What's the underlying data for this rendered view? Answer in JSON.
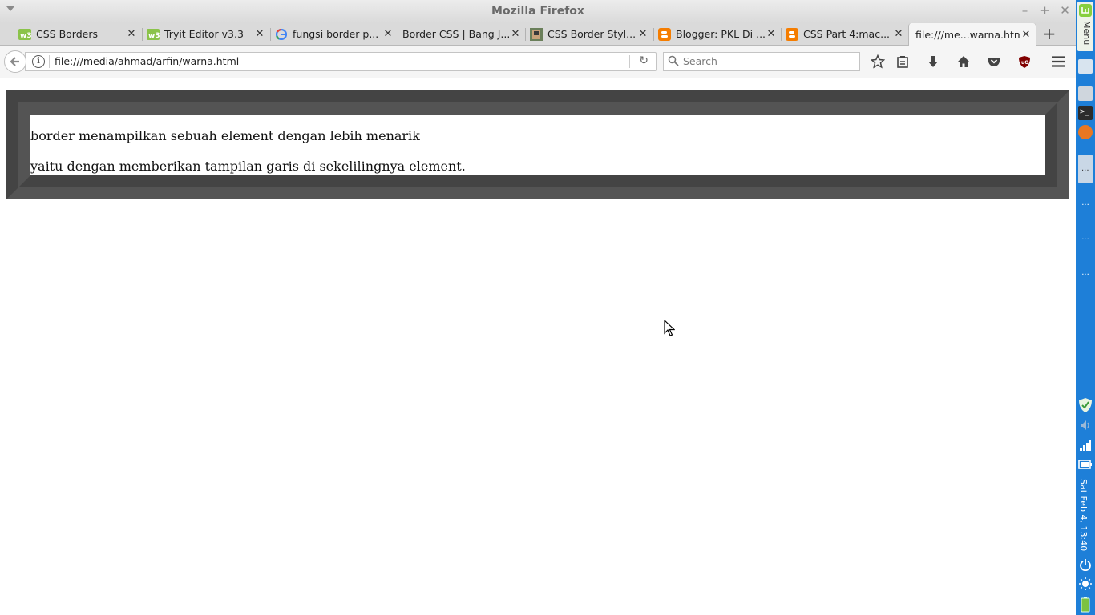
{
  "window": {
    "title": "Mozilla Firefox"
  },
  "tabs": [
    {
      "label": "CSS Borders",
      "favicon": "w3schools-icon"
    },
    {
      "label": "Tryit Editor v3.3",
      "favicon": "w3schools-icon"
    },
    {
      "label": "fungsi border p...",
      "favicon": "google-icon"
    },
    {
      "label": "Border CSS | Bang J...",
      "favicon": "none"
    },
    {
      "label": "CSS Border Styl...",
      "favicon": "image-thumb-icon"
    },
    {
      "label": "Blogger: PKL Di ...",
      "favicon": "blogger-icon"
    },
    {
      "label": "CSS Part 4:mac...",
      "favicon": "blogger-icon"
    },
    {
      "label": "file:///me...warna.html",
      "favicon": "none",
      "active": true
    }
  ],
  "navbar": {
    "url": "file:///media/ahmad/arfin/warna.html",
    "search_placeholder": "Search"
  },
  "page": {
    "line1": "border menampilkan sebuah element dengan lebih menarik",
    "line2": "yaitu dengan memberikan tampilan garis di sekelilingnya element."
  },
  "colors": {
    "border_dark": "#444444",
    "border_light": "#a8a8a8",
    "panel_blue": "#1e7fd8"
  },
  "panel": {
    "menu_label": "Menu",
    "clock": "Sat Feb 4, 13:40"
  }
}
